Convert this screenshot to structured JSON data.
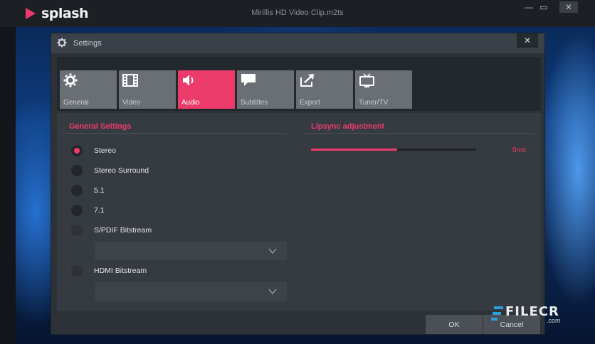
{
  "app": {
    "logo_text": "splash",
    "document_title": "Mirillis HD Video Clip.m2ts",
    "window_controls": {
      "minimize": "—",
      "maximize": "▭",
      "close": "✕"
    }
  },
  "dialog": {
    "title": "Settings",
    "close_glyph": "✕",
    "tabs": [
      {
        "label": "General",
        "icon": "gear-icon",
        "active": false
      },
      {
        "label": "Video",
        "icon": "film-icon",
        "active": false
      },
      {
        "label": "Audio",
        "icon": "speaker-icon",
        "active": true
      },
      {
        "label": "Subtitles",
        "icon": "speech-bubble-icon",
        "active": false
      },
      {
        "label": "Export",
        "icon": "export-icon",
        "active": false
      },
      {
        "label": "Tuner/TV",
        "icon": "tv-icon",
        "active": false
      }
    ],
    "general_settings": {
      "title": "General Settings",
      "options": [
        {
          "label": "Stereo",
          "checked": true,
          "enabled": true
        },
        {
          "label": "Stereo Surround",
          "checked": false,
          "enabled": true
        },
        {
          "label": "5.1",
          "checked": false,
          "enabled": true
        },
        {
          "label": "7.1",
          "checked": false,
          "enabled": true
        },
        {
          "label": "S/PDIF Bitstream",
          "checked": false,
          "enabled": false
        },
        {
          "label": "HDMI Bitstream",
          "checked": false,
          "enabled": false
        }
      ],
      "spdif_dropdown_value": "",
      "hdmi_dropdown_value": ""
    },
    "lipsync": {
      "title": "Lipsync adjustment",
      "value_label": "0ms",
      "slider_level": 0.52
    },
    "buttons": {
      "ok": "OK",
      "cancel": "Cancel"
    }
  },
  "watermark": {
    "text": "FILECR",
    "sub": ".com"
  },
  "colors": {
    "accent": "#ec3b6a",
    "panel": "#363b42",
    "dialog": "#2d3238",
    "tab_inactive": "#6a6f75"
  }
}
